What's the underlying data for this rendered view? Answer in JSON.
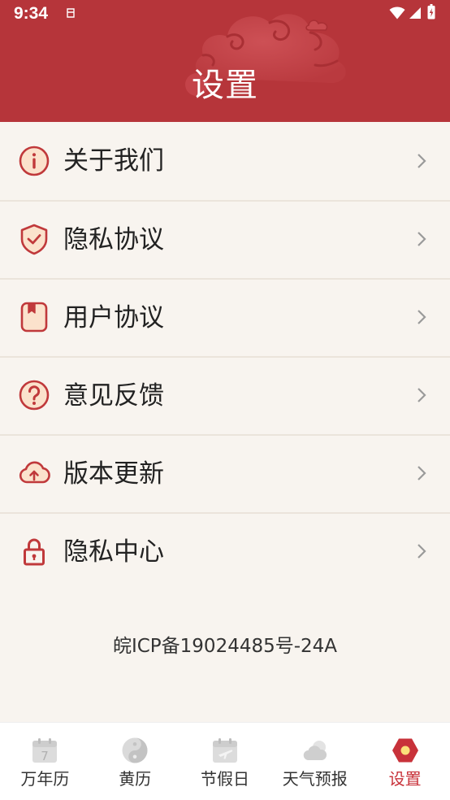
{
  "status_bar": {
    "time": "9:34"
  },
  "header": {
    "title": "设置"
  },
  "menu": {
    "items": [
      {
        "label": "关于我们",
        "icon": "info-icon"
      },
      {
        "label": "隐私协议",
        "icon": "shield-check-icon"
      },
      {
        "label": "用户协议",
        "icon": "book-icon"
      },
      {
        "label": "意见反馈",
        "icon": "question-icon"
      },
      {
        "label": "版本更新",
        "icon": "cloud-upload-icon"
      },
      {
        "label": "隐私中心",
        "icon": "lock-icon"
      }
    ]
  },
  "footer": {
    "icp": "皖ICP备19024485号-24A"
  },
  "bottom_nav": {
    "items": [
      {
        "label": "万年历",
        "icon": "calendar-icon",
        "icon_text": "7",
        "active": false
      },
      {
        "label": "黄历",
        "icon": "yin-yang-icon",
        "active": false
      },
      {
        "label": "节假日",
        "icon": "holiday-calendar-icon",
        "active": false
      },
      {
        "label": "天气预报",
        "icon": "weather-icon",
        "active": false
      },
      {
        "label": "设置",
        "icon": "settings-hexagon-icon",
        "active": true
      }
    ]
  },
  "colors": {
    "header_bg": "#b6353a",
    "accent": "#c0393b",
    "icon_fill": "#fbe2cc",
    "list_bg": "#f8f4ef",
    "nav_bg": "#ffffff",
    "nav_active": "#c8323a",
    "nav_inactive_icon": "#cfcfcf"
  }
}
